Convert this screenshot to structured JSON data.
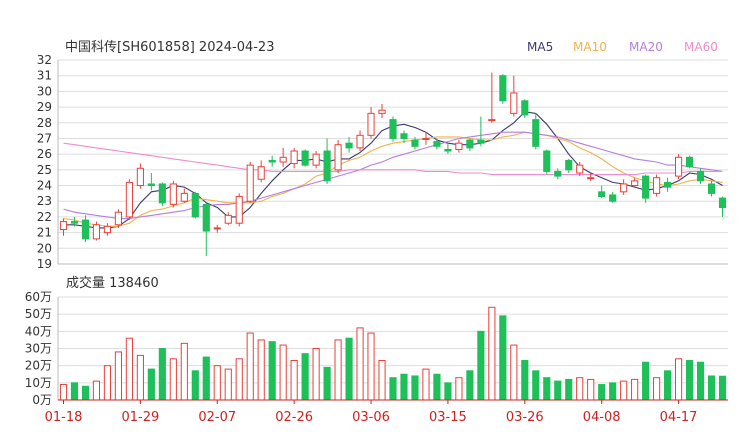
{
  "header": {
    "title": "中国科传[SH601858] 2024-04-23"
  },
  "legend": [
    {
      "label": "MA5",
      "color": "#3b3a6e"
    },
    {
      "label": "MA10",
      "color": "#f0b34a"
    },
    {
      "label": "MA20",
      "color": "#b57ee0"
    },
    {
      "label": "MA60",
      "color": "#ef8ccd"
    }
  ],
  "colors": {
    "up": "#e8413a",
    "down": "#1fbf5a",
    "grid": "#dddddd"
  },
  "chart_data": [
    {
      "type": "candlestick",
      "ylim": [
        19,
        32
      ],
      "yticks": [
        "19",
        "20",
        "21",
        "22",
        "23",
        "24",
        "25",
        "26",
        "27",
        "28",
        "29",
        "30",
        "31",
        "32"
      ],
      "x": [
        "01-18",
        "01-19",
        "01-22",
        "01-23",
        "01-24",
        "01-25",
        "01-26",
        "01-29",
        "01-30",
        "01-31",
        "02-01",
        "02-02",
        "02-05",
        "02-06",
        "02-07",
        "02-08",
        "02-19",
        "02-20",
        "02-21",
        "02-22",
        "02-23",
        "02-26",
        "02-27",
        "02-28",
        "02-29",
        "03-01",
        "03-04",
        "03-05",
        "03-06",
        "03-07",
        "03-08",
        "03-11",
        "03-12",
        "03-13",
        "03-14",
        "03-15",
        "03-18",
        "03-19",
        "03-20",
        "03-21",
        "03-22",
        "03-25",
        "03-26",
        "03-27",
        "03-28",
        "03-29",
        "04-01",
        "04-02",
        "04-03",
        "04-08",
        "04-09",
        "04-10",
        "04-11",
        "04-12",
        "04-15",
        "04-16",
        "04-17",
        "04-18",
        "04-19",
        "04-22",
        "04-23"
      ],
      "open": [
        21.2,
        21.7,
        21.8,
        20.6,
        21.0,
        21.5,
        22.0,
        24.0,
        24.1,
        24.1,
        22.8,
        23.0,
        23.5,
        22.8,
        21.3,
        21.6,
        21.6,
        23.0,
        24.4,
        25.6,
        25.5,
        25.4,
        26.2,
        25.3,
        26.2,
        25.0,
        26.7,
        26.4,
        27.2,
        28.6,
        28.2,
        27.3,
        26.9,
        27.0,
        26.8,
        26.3,
        26.3,
        26.9,
        26.9,
        28.2,
        31.0,
        28.6,
        29.4,
        28.2,
        26.2,
        24.9,
        25.6,
        24.8,
        24.5,
        23.6,
        23.4,
        23.6,
        24.0,
        24.6,
        23.5,
        24.2,
        24.6,
        25.8,
        24.9,
        24.1,
        23.2
      ],
      "close": [
        21.7,
        21.6,
        20.6,
        21.5,
        21.4,
        22.3,
        24.2,
        25.1,
        24.0,
        22.9,
        24.1,
        23.5,
        22.0,
        21.1,
        21.3,
        22.1,
        23.3,
        25.3,
        25.2,
        25.5,
        25.8,
        26.2,
        25.3,
        26.0,
        24.3,
        26.6,
        26.4,
        27.2,
        28.6,
        28.8,
        27.0,
        27.0,
        26.5,
        27.0,
        26.5,
        26.2,
        26.7,
        26.4,
        26.7,
        28.2,
        29.4,
        29.9,
        28.5,
        26.5,
        24.9,
        24.6,
        25.0,
        25.3,
        24.5,
        23.3,
        23.0,
        24.1,
        24.3,
        23.2,
        24.5,
        23.9,
        25.8,
        25.2,
        24.3,
        23.5,
        22.6
      ],
      "high": [
        21.9,
        22.0,
        22.1,
        21.7,
        21.6,
        22.5,
        24.4,
        25.4,
        24.8,
        24.2,
        24.3,
        23.8,
        23.6,
        22.9,
        21.5,
        22.3,
        23.5,
        25.5,
        25.6,
        25.9,
        26.4,
        26.4,
        26.3,
        26.2,
        27.0,
        26.9,
        27.1,
        27.5,
        29.0,
        29.2,
        28.4,
        27.5,
        27.1,
        27.4,
        27.0,
        26.7,
        26.9,
        27.0,
        28.4,
        31.2,
        31.1,
        31.0,
        29.5,
        28.6,
        26.3,
        25.1,
        25.7,
        25.5,
        24.8,
        24.0,
        23.6,
        24.4,
        24.5,
        24.7,
        24.7,
        24.5,
        26.0,
        25.9,
        25.1,
        24.3,
        23.3
      ],
      "low": [
        20.8,
        21.4,
        20.4,
        20.5,
        20.8,
        21.3,
        21.8,
        23.8,
        23.7,
        22.7,
        22.6,
        22.9,
        21.9,
        19.5,
        21.0,
        21.5,
        21.4,
        22.9,
        24.2,
        25.2,
        25.2,
        25.1,
        25.2,
        25.1,
        24.1,
        24.8,
        26.1,
        26.2,
        27.0,
        28.3,
        26.8,
        26.7,
        26.3,
        26.6,
        26.3,
        26.0,
        26.1,
        26.2,
        26.5,
        28.0,
        29.2,
        28.4,
        28.3,
        26.3,
        24.7,
        24.4,
        24.8,
        24.6,
        24.3,
        23.2,
        22.9,
        23.4,
        23.9,
        22.9,
        23.3,
        23.6,
        24.4,
        25.1,
        24.1,
        23.3,
        22.0
      ],
      "series": [
        {
          "name": "MA5",
          "values": [
            21.5,
            21.5,
            21.4,
            21.3,
            21.3,
            21.4,
            21.9,
            22.9,
            23.6,
            23.7,
            24.0,
            23.9,
            23.5,
            22.9,
            22.6,
            22.0,
            22.0,
            22.6,
            23.5,
            24.3,
            25.0,
            25.6,
            25.6,
            25.7,
            25.5,
            25.7,
            25.7,
            26.1,
            26.7,
            27.5,
            27.8,
            27.9,
            27.7,
            27.4,
            26.9,
            26.7,
            26.6,
            26.6,
            26.7,
            26.9,
            27.5,
            28.0,
            28.7,
            28.6,
            27.9,
            27.0,
            26.0,
            25.2,
            24.8,
            24.5,
            24.2,
            24.1,
            23.9,
            23.7,
            23.8,
            24.0,
            24.3,
            24.8,
            24.7,
            24.4,
            24.0
          ]
        },
        {
          "name": "MA10",
          "values": [
            21.9,
            21.8,
            21.6,
            21.5,
            21.4,
            21.4,
            21.6,
            22.1,
            22.4,
            22.5,
            22.7,
            22.9,
            23.2,
            23.1,
            23.0,
            22.9,
            22.9,
            22.9,
            23.0,
            23.3,
            23.5,
            23.8,
            24.1,
            24.6,
            24.8,
            25.3,
            25.6,
            25.8,
            26.2,
            26.5,
            26.7,
            26.8,
            26.9,
            27.0,
            27.1,
            27.1,
            27.1,
            27.0,
            26.9,
            26.9,
            27.1,
            27.2,
            27.4,
            27.3,
            27.2,
            27.0,
            26.8,
            26.4,
            26.1,
            25.7,
            25.2,
            24.8,
            24.5,
            24.3,
            24.1,
            24.0,
            24.1,
            24.3,
            24.4,
            24.3,
            24.2
          ]
        },
        {
          "name": "MA20",
          "values": [
            22.5,
            22.3,
            22.2,
            22.1,
            22.0,
            21.9,
            21.9,
            22.0,
            22.1,
            22.2,
            22.3,
            22.4,
            22.6,
            22.7,
            22.8,
            22.8,
            22.9,
            23.0,
            23.2,
            23.4,
            23.6,
            23.8,
            24.0,
            24.2,
            24.4,
            24.6,
            24.8,
            25.0,
            25.3,
            25.5,
            25.8,
            26.0,
            26.2,
            26.4,
            26.6,
            26.8,
            27.0,
            27.1,
            27.2,
            27.3,
            27.4,
            27.4,
            27.4,
            27.3,
            27.2,
            27.1,
            26.9,
            26.7,
            26.5,
            26.3,
            26.1,
            25.9,
            25.7,
            25.6,
            25.5,
            25.3,
            25.3,
            25.2,
            25.1,
            25.0,
            24.9
          ]
        },
        {
          "name": "MA60",
          "values": [
            26.7,
            26.6,
            26.5,
            26.4,
            26.3,
            26.2,
            26.1,
            26.0,
            25.9,
            25.8,
            25.7,
            25.6,
            25.5,
            25.4,
            25.3,
            25.2,
            25.1,
            25.0,
            25.0,
            24.9,
            24.9,
            24.9,
            24.9,
            24.9,
            24.9,
            24.9,
            25.0,
            25.0,
            25.0,
            25.0,
            25.0,
            25.0,
            25.0,
            24.9,
            24.9,
            24.9,
            24.8,
            24.8,
            24.8,
            24.7,
            24.7,
            24.7,
            24.7,
            24.7,
            24.7,
            24.7,
            24.7,
            24.7,
            24.7,
            24.7,
            24.7,
            24.7,
            24.7,
            24.8,
            24.8,
            24.8,
            24.8,
            24.9,
            24.9,
            24.9,
            24.9
          ]
        }
      ]
    },
    {
      "type": "bar",
      "title": "成交量 138460",
      "yticks": [
        "0万",
        "10万",
        "20万",
        "30万",
        "40万",
        "50万",
        "60万"
      ],
      "ylim": [
        0,
        600000
      ],
      "x_tick_labels": [
        "01-18",
        "01-29",
        "02-07",
        "02-26",
        "03-06",
        "03-15",
        "03-26",
        "04-08",
        "04-17"
      ],
      "x_tick_index": [
        0,
        7,
        14,
        21,
        28,
        35,
        42,
        49,
        56
      ],
      "values": [
        90000,
        100000,
        80000,
        110000,
        200000,
        280000,
        360000,
        260000,
        180000,
        300000,
        240000,
        330000,
        170000,
        250000,
        200000,
        180000,
        240000,
        390000,
        350000,
        340000,
        320000,
        230000,
        270000,
        300000,
        190000,
        350000,
        360000,
        420000,
        390000,
        230000,
        130000,
        150000,
        140000,
        180000,
        150000,
        100000,
        130000,
        170000,
        400000,
        540000,
        490000,
        320000,
        230000,
        170000,
        130000,
        110000,
        120000,
        130000,
        120000,
        90000,
        100000,
        110000,
        120000,
        220000,
        130000,
        170000,
        240000,
        230000,
        220000,
        140000,
        138460
      ]
    }
  ]
}
